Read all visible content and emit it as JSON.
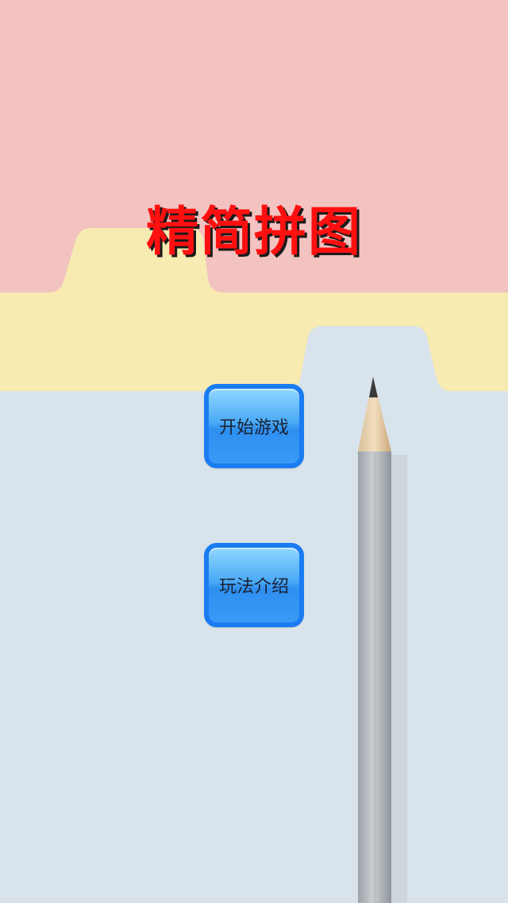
{
  "title": "精简拼图",
  "menu": {
    "start_label": "开始游戏",
    "help_label": "玩法介绍"
  },
  "colors": {
    "title": "#ff1010",
    "title_shadow": "#1a1a1a",
    "button_border": "#1a7cf2",
    "button_fill": "#4aaaf5",
    "background_pink": "#f2c2c0",
    "background_yellow": "#f7ecb0",
    "background_blue": "#d8e2ea"
  }
}
